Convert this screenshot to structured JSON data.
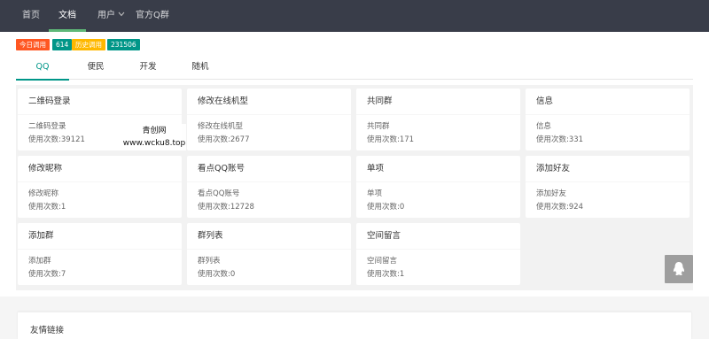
{
  "nav": {
    "items": [
      {
        "label": "首页"
      },
      {
        "label": "文档"
      },
      {
        "label": "用户"
      },
      {
        "label": "官方Q群"
      }
    ],
    "user_chevron": "chevron-down-icon"
  },
  "stats": {
    "today_label": "今日调用",
    "today_value": "614",
    "history_label": "历史调用",
    "history_value": "231506"
  },
  "tabs": [
    {
      "label": "QQ"
    },
    {
      "label": "便民"
    },
    {
      "label": "开发"
    },
    {
      "label": "随机"
    }
  ],
  "cards": [
    {
      "title": "二维码登录",
      "desc": "二维码登录",
      "count": "使用次数:39121"
    },
    {
      "title": "修改在线机型",
      "desc": "修改在线机型",
      "count": "使用次数:2677"
    },
    {
      "title": "共同群",
      "desc": "共同群",
      "count": "使用次数:171"
    },
    {
      "title": "信息",
      "desc": "信息",
      "count": "使用次数:331"
    },
    {
      "title": "修改昵称",
      "desc": "修改昵称",
      "count": "使用次数:1"
    },
    {
      "title": "看点QQ账号",
      "desc": "看点QQ账号",
      "count": "使用次数:12728"
    },
    {
      "title": "单项",
      "desc": "单项",
      "count": "使用次数:0"
    },
    {
      "title": "添加好友",
      "desc": "添加好友",
      "count": "使用次数:924"
    },
    {
      "title": "添加群",
      "desc": "添加群",
      "count": "使用次数:7"
    },
    {
      "title": "群列表",
      "desc": "群列表",
      "count": "使用次数:0"
    },
    {
      "title": "空间留言",
      "desc": "空间留言",
      "count": "使用次数:1"
    }
  ],
  "watermark": {
    "line1": "青创网",
    "line2": "www.wcku8.top"
  },
  "float_button": {
    "icon": "qq-penguin-icon"
  },
  "links": {
    "title": "友情链接"
  },
  "colors": {
    "nav_bg": "#393d49",
    "accent": "#009688",
    "nav_active": "#5fb878",
    "red": "#ff5722",
    "orange": "#ffb800"
  }
}
